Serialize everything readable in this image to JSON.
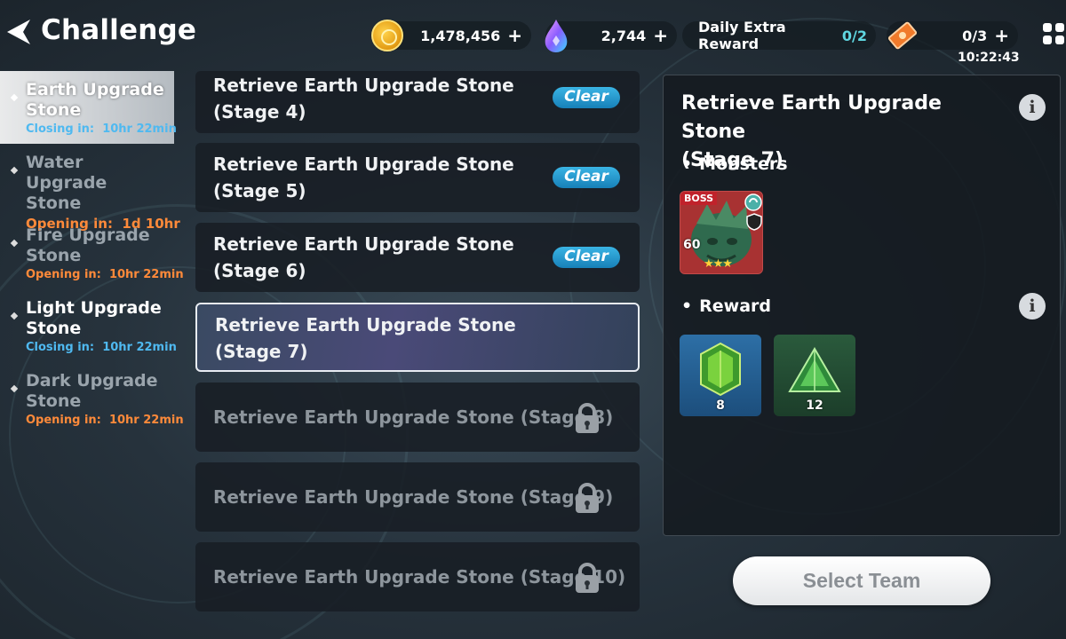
{
  "header": {
    "title": "Challenge",
    "gold": "1,478,456",
    "gems": "2,744",
    "daily_label": "Daily Extra Reward",
    "daily_count": "0/2",
    "tickets": "0/3",
    "timer": "10:22:43",
    "plus": "+"
  },
  "sidebar": {
    "items": [
      {
        "name": "Earth Upgrade Stone",
        "status_label": "Closing in:",
        "status_time": "10hr 22min"
      },
      {
        "name": "Water Upgrade Stone",
        "status_label": "Opening in:",
        "status_time": "1d 10hr"
      },
      {
        "name": "Fire Upgrade Stone",
        "status_label": "Opening in:",
        "status_time": "10hr 22min"
      },
      {
        "name": "Light Upgrade Stone",
        "status_label": "Closing in:",
        "status_time": "10hr 22min"
      },
      {
        "name": "Dark Upgrade Stone",
        "status_label": "Opening in:",
        "status_time": "10hr 22min"
      }
    ]
  },
  "stages": [
    {
      "line1": "Retrieve Earth Upgrade Stone",
      "line2": "(Stage 4)",
      "badge": "Clear"
    },
    {
      "line1": "Retrieve Earth Upgrade Stone",
      "line2": "(Stage 5)",
      "badge": "Clear"
    },
    {
      "line1": "Retrieve Earth Upgrade Stone",
      "line2": "(Stage 6)",
      "badge": "Clear"
    },
    {
      "line1": "Retrieve Earth Upgrade Stone",
      "line2": "(Stage 7)"
    },
    {
      "line1": "Retrieve Earth Upgrade Stone (Stage 8)"
    },
    {
      "line1": "Retrieve Earth Upgrade Stone (Stage 9)"
    },
    {
      "line1": "Retrieve Earth Upgrade Stone (Stage 10)"
    }
  ],
  "detail": {
    "title_line1": "Retrieve Earth Upgrade Stone",
    "title_line2": "(Stage 7)",
    "monsters_label": "Monsters",
    "monster": {
      "tag": "BOSS",
      "level": "60",
      "stars": "★★★"
    },
    "reward_label": "Reward",
    "rewards": [
      {
        "icon": "green-gem-icon",
        "qty": "8"
      },
      {
        "icon": "green-pyramid-icon",
        "qty": "12"
      }
    ],
    "info_glyph": "i"
  },
  "select_team": "Select Team",
  "colors": {
    "clear_badge": "#2a9fd6",
    "closing_status": "#4fb9f0",
    "opening_status": "#ff8a3a",
    "daily_count": "#5fd6e0"
  }
}
